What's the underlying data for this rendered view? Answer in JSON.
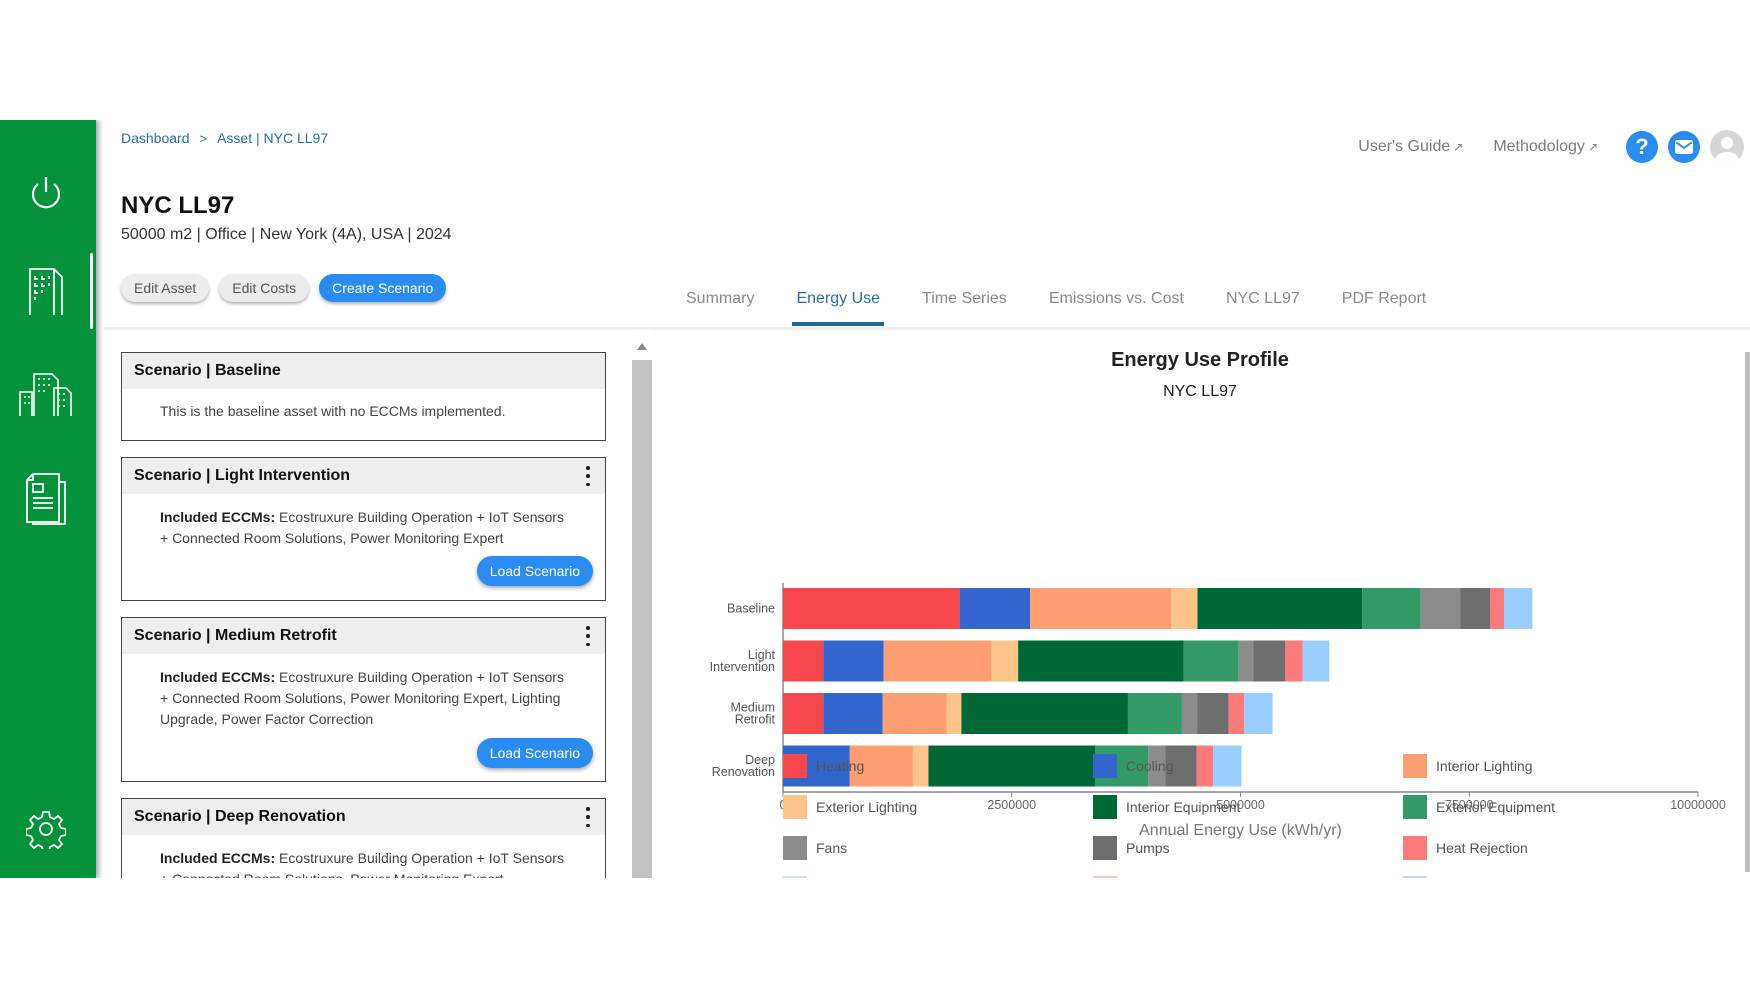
{
  "sidebar": {
    "items": [
      {
        "name": "power",
        "icon": "power-icon"
      },
      {
        "name": "asset",
        "icon": "building-icon",
        "active": true
      },
      {
        "name": "portfolio",
        "icon": "buildings-icon"
      },
      {
        "name": "reports",
        "icon": "document-icon"
      },
      {
        "name": "settings",
        "icon": "gear-icon"
      }
    ]
  },
  "header": {
    "breadcrumb": [
      "Dashboard",
      "Asset | NYC LL97"
    ],
    "breadcrumb_sep": ">",
    "links": [
      {
        "label": "User's Guide",
        "icon": "external-link-icon"
      },
      {
        "label": "Methodology",
        "icon": "external-link-icon"
      }
    ],
    "help_label": "?",
    "accent": "#2a8bf0"
  },
  "asset": {
    "title": "NYC LL97",
    "subtitle": "50000 m2 | Office | New York (4A), USA | 2024",
    "buttons": {
      "edit_asset": "Edit Asset",
      "edit_costs": "Edit Costs",
      "create_scenario": "Create Scenario"
    }
  },
  "tabs": [
    {
      "label": "Summary",
      "active": false
    },
    {
      "label": "Energy Use",
      "active": true
    },
    {
      "label": "Time Series",
      "active": false
    },
    {
      "label": "Emissions vs. Cost",
      "active": false
    },
    {
      "label": "NYC LL97",
      "active": false
    },
    {
      "label": "PDF Report",
      "active": false
    }
  ],
  "scenarios": [
    {
      "title": "Scenario | Baseline",
      "description": "This is the baseline asset with no ECCMs implemented.",
      "has_menu": false
    },
    {
      "title": "Scenario | Light Intervention",
      "eccm_label": "Included ECCMs:",
      "eccms": "Ecostruxure Building Operation + IoT Sensors + Connected Room Solutions, Power Monitoring Expert",
      "load_label": "Load Scenario",
      "has_menu": true
    },
    {
      "title": "Scenario | Medium Retrofit",
      "eccm_label": "Included ECCMs:",
      "eccms": "Ecostruxure Building Operation + IoT Sensors + Connected Room Solutions, Power Monitoring Expert, Lighting Upgrade, Power Factor Correction",
      "load_label": "Load Scenario",
      "has_menu": true
    },
    {
      "title": "Scenario | Deep Renovation",
      "eccm_label": "Included ECCMs:",
      "eccms": "Ecostruxure Building Operation + IoT Sensors + Connected Room Solutions, Power Monitoring Expert",
      "has_menu": true
    }
  ],
  "chart_data": {
    "type": "bar",
    "orientation": "horizontal",
    "stacked": true,
    "title": "Energy Use Profile",
    "subtitle": "NYC LL97",
    "xlabel": "Annual Energy Use (kWh/yr)",
    "ylabel": "",
    "xlim": [
      0,
      10000000
    ],
    "xticks": [
      0,
      2500000,
      5000000,
      7500000,
      10000000
    ],
    "xtick_labels": [
      "0",
      "2500000",
      "5000000",
      "7500000",
      "10000000"
    ],
    "categories": [
      "Baseline",
      "Light Intervention",
      "Medium Retrofit",
      "Deep Renovation"
    ],
    "category_labels": [
      [
        "Baseline"
      ],
      [
        "Light",
        "Intervention"
      ],
      [
        "Medium",
        "Retrofit"
      ],
      [
        "Deep",
        "Renovation"
      ]
    ],
    "grid": false,
    "legend_position": "bottom",
    "series": [
      {
        "name": "Heating",
        "color": "#f5474c",
        "values": [
          1930000,
          440000,
          440000,
          0
        ]
      },
      {
        "name": "Cooling",
        "color": "#3366cc",
        "values": [
          770000,
          660000,
          650000,
          730000
        ]
      },
      {
        "name": "Interior Lighting",
        "color": "#fc9d72",
        "values": [
          1540000,
          1180000,
          700000,
          690000
        ]
      },
      {
        "name": "Exterior Lighting",
        "color": "#fdc489",
        "values": [
          290000,
          290000,
          160000,
          170000
        ]
      },
      {
        "name": "Interior Equipment",
        "color": "#006837",
        "values": [
          1800000,
          1810000,
          1820000,
          1820000
        ]
      },
      {
        "name": "Exterior Equipment",
        "color": "#339966",
        "values": [
          640000,
          600000,
          590000,
          580000
        ]
      },
      {
        "name": "Fans",
        "color": "#8c8c8c",
        "values": [
          430000,
          160000,
          170000,
          190000
        ]
      },
      {
        "name": "Pumps",
        "color": "#6e6e6e",
        "values": [
          330000,
          350000,
          340000,
          340000
        ]
      },
      {
        "name": "Heat Rejection",
        "color": "#fb7a7a",
        "values": [
          150000,
          190000,
          170000,
          180000
        ]
      },
      {
        "name": "",
        "color": "#99ccff",
        "values": [
          310000,
          290000,
          310000,
          310000
        ]
      }
    ],
    "legend_partial_row_colors": [
      "#cfe6ef",
      "#f8c6c6",
      "#bcd9f0"
    ]
  }
}
